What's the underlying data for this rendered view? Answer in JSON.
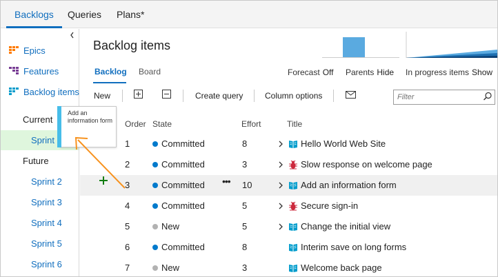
{
  "topnav": {
    "tabs": [
      {
        "label": "Backlogs",
        "active": true
      },
      {
        "label": "Queries",
        "active": false
      },
      {
        "label": "Plans*",
        "active": false
      }
    ]
  },
  "sidebar": {
    "collapse_icon": "chevron-left-icon",
    "items": [
      {
        "label": "Epics",
        "icon": "epics-icon",
        "color": "#ff7b00"
      },
      {
        "label": "Features",
        "icon": "features-icon",
        "color": "#773b93"
      },
      {
        "label": "Backlog items",
        "icon": "backlog-items-icon",
        "color": "#009ccc",
        "active": true
      }
    ],
    "current_label": "Current",
    "current_sprints": [
      "Sprint 1"
    ],
    "future_label": "Future",
    "future_sprints": [
      "Sprint 2",
      "Sprint 3",
      "Sprint 4",
      "Sprint 5",
      "Sprint 6"
    ]
  },
  "drag_tooltip": {
    "text": "Add an information form"
  },
  "main": {
    "title": "Backlog items",
    "subtabs": [
      {
        "label": "Backlog",
        "active": true
      },
      {
        "label": "Board",
        "active": false
      }
    ],
    "options": [
      {
        "label": "Forecast",
        "value": "Off"
      },
      {
        "label": "Parents",
        "value": "Hide"
      },
      {
        "label": "In progress items",
        "value": "Show"
      }
    ]
  },
  "toolbar": {
    "new_label": "New",
    "expand_icon": "expand-all-icon",
    "collapse_icon": "collapse-all-icon",
    "create_query_label": "Create query",
    "column_options_label": "Column options",
    "email_icon": "mail-icon",
    "filter_placeholder": "Filter"
  },
  "table": {
    "headers": {
      "order": "Order",
      "state": "State",
      "effort": "Effort",
      "title": "Title"
    },
    "rows": [
      {
        "order": "1",
        "state": "Committed",
        "state_color": "#007acc",
        "effort": "8",
        "title": "Hello World Web Site",
        "type": "backlog-item",
        "expandable": true
      },
      {
        "order": "2",
        "state": "Committed",
        "state_color": "#007acc",
        "effort": "3",
        "title": "Slow response on welcome page",
        "type": "bug",
        "expandable": true
      },
      {
        "order": "3",
        "state": "Committed",
        "state_color": "#007acc",
        "effort": "10",
        "title": "Add an information form",
        "type": "backlog-item",
        "expandable": true
      },
      {
        "order": "4",
        "state": "Committed",
        "state_color": "#007acc",
        "effort": "5",
        "title": "Secure sign-in",
        "type": "bug",
        "expandable": true
      },
      {
        "order": "5",
        "state": "New",
        "state_color": "#b2b2b2",
        "effort": "5",
        "title": "Change the initial view",
        "type": "backlog-item",
        "expandable": true
      },
      {
        "order": "6",
        "state": "Committed",
        "state_color": "#007acc",
        "effort": "8",
        "title": "Interim save on long forms",
        "type": "backlog-item",
        "expandable": false
      },
      {
        "order": "7",
        "state": "New",
        "state_color": "#b2b2b2",
        "effort": "3",
        "title": "Welcome back page",
        "type": "backlog-item",
        "expandable": false
      }
    ]
  },
  "colors": {
    "accent": "#106ebe",
    "backlog_item": "#009ccc",
    "bug": "#cc293d",
    "sprint_highlight": "#dff6dd",
    "drag_accent": "#47bde9",
    "annotation_arrow": "#f7921e",
    "add_icon": "#107c10"
  }
}
